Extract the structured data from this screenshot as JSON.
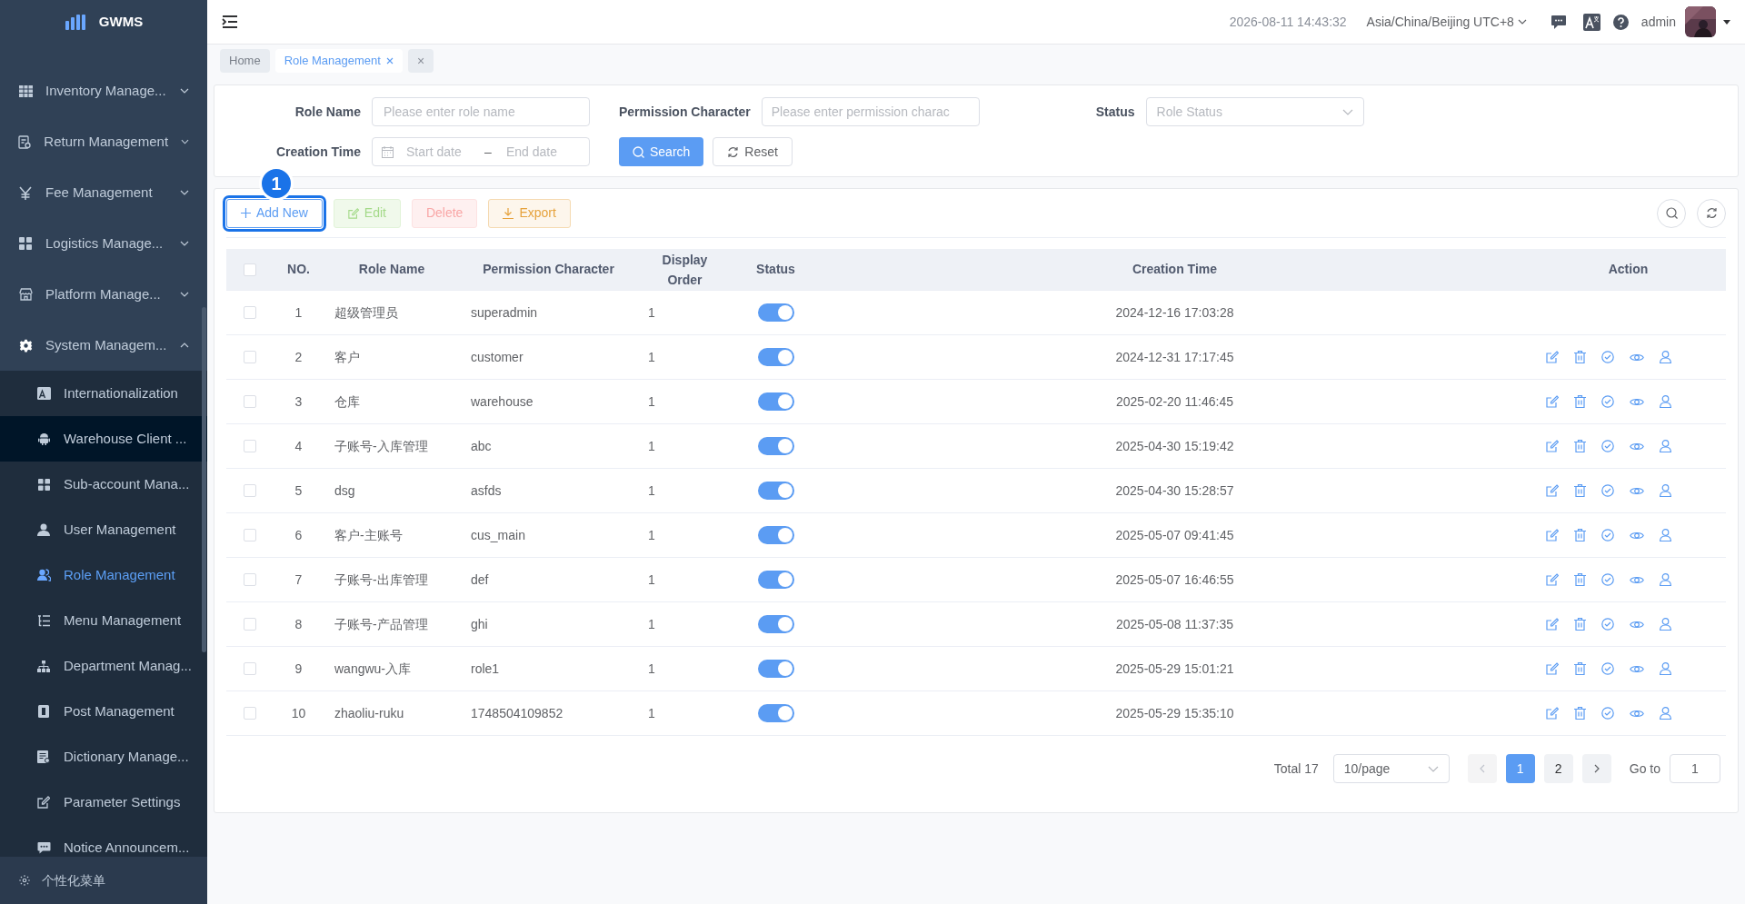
{
  "sidebar": {
    "logo": "GWMS",
    "items": [
      {
        "label": "Inventory Manage...",
        "expanded": false
      },
      {
        "label": "Return Management",
        "expanded": false
      },
      {
        "label": "Fee Management",
        "expanded": false
      },
      {
        "label": "Logistics Manage...",
        "expanded": false
      },
      {
        "label": "Platform Manage...",
        "expanded": false
      },
      {
        "label": "System Managem...",
        "expanded": true,
        "children": [
          {
            "label": "Internationalization",
            "selected": false,
            "hovered": false
          },
          {
            "label": "Warehouse Client ...",
            "selected": false,
            "hovered": true
          },
          {
            "label": "Sub-account Mana...",
            "selected": false,
            "hovered": false
          },
          {
            "label": "User Management",
            "selected": false,
            "hovered": false
          },
          {
            "label": "Role Management",
            "selected": true,
            "hovered": false
          },
          {
            "label": "Menu Management",
            "selected": false,
            "hovered": false
          },
          {
            "label": "Department Manag...",
            "selected": false,
            "hovered": false
          },
          {
            "label": "Post Management",
            "selected": false,
            "hovered": false
          },
          {
            "label": "Dictionary Manage...",
            "selected": false,
            "hovered": false
          },
          {
            "label": "Parameter Settings",
            "selected": false,
            "hovered": false
          },
          {
            "label": "Notice Announcem...",
            "selected": false,
            "hovered": false
          }
        ]
      }
    ],
    "footer": "个性化菜单"
  },
  "top_bar": {
    "datetime": "2026-08-11 14:43:32",
    "timezone": "Asia/China/Beijing UTC+8",
    "username": "admin"
  },
  "tabs": [
    {
      "label": "Home",
      "selected": false,
      "closable": false
    },
    {
      "label": "Role Management",
      "selected": true,
      "closable": true
    }
  ],
  "close_tabs_button": "×",
  "filters": {
    "role_name": {
      "label": "Role Name",
      "placeholder": "Please enter role name"
    },
    "permission_character": {
      "label": "Permission Character",
      "placeholder": "Please enter permission charac"
    },
    "status": {
      "label": "Status",
      "placeholder": "Role Status"
    },
    "creation_time": {
      "label": "Creation Time",
      "start_placeholder": "Start date",
      "separator": "–",
      "end_placeholder": "End date"
    },
    "search_button": "Search",
    "reset_button": "Reset"
  },
  "toolbar": [
    {
      "kind": "add",
      "label": "Add New",
      "disabled": false,
      "highlighted": true,
      "callout": "1"
    },
    {
      "kind": "edit",
      "label": "Edit",
      "disabled": true,
      "highlighted": false
    },
    {
      "kind": "delete",
      "label": "Delete",
      "disabled": true,
      "highlighted": false
    },
    {
      "kind": "export",
      "label": "Export",
      "disabled": false,
      "highlighted": false
    }
  ],
  "table": {
    "header_checked": false,
    "columns": [
      "NO.",
      "Role Name",
      "Permission Character",
      "Display Order",
      "Status",
      "Creation Time",
      "Action"
    ],
    "rows": [
      {
        "checked": false,
        "no": "1",
        "role_name": "超级管理员",
        "permission": "superadmin",
        "order": "1",
        "enabled": true,
        "created": "2024-12-16 17:03:28",
        "actions": false
      },
      {
        "checked": false,
        "no": "2",
        "role_name": "客户",
        "permission": "customer",
        "order": "1",
        "enabled": true,
        "created": "2024-12-31 17:17:45",
        "actions": true
      },
      {
        "checked": false,
        "no": "3",
        "role_name": "仓库",
        "permission": "warehouse",
        "order": "1",
        "enabled": true,
        "created": "2025-02-20 11:46:45",
        "actions": true
      },
      {
        "checked": false,
        "no": "4",
        "role_name": "子账号-入库管理",
        "permission": "abc",
        "order": "1",
        "enabled": true,
        "created": "2025-04-30 15:19:42",
        "actions": true
      },
      {
        "checked": false,
        "no": "5",
        "role_name": "dsg",
        "permission": "asfds",
        "order": "1",
        "enabled": true,
        "created": "2025-04-30 15:28:57",
        "actions": true
      },
      {
        "checked": false,
        "no": "6",
        "role_name": "客户-主账号",
        "permission": "cus_main",
        "order": "1",
        "enabled": true,
        "created": "2025-05-07 09:41:45",
        "actions": true
      },
      {
        "checked": false,
        "no": "7",
        "role_name": "子账号-出库管理",
        "permission": "def",
        "order": "1",
        "enabled": true,
        "created": "2025-05-07 16:46:55",
        "actions": true
      },
      {
        "checked": false,
        "no": "8",
        "role_name": "子账号-产品管理",
        "permission": "ghi",
        "order": "1",
        "enabled": true,
        "created": "2025-05-08 11:37:35",
        "actions": true
      },
      {
        "checked": false,
        "no": "9",
        "role_name": "wangwu-入库",
        "permission": "role1",
        "order": "1",
        "enabled": true,
        "created": "2025-05-29 15:01:21",
        "actions": true
      },
      {
        "checked": false,
        "no": "10",
        "role_name": "zhaoliu-ruku",
        "permission": "1748504109852",
        "order": "1",
        "enabled": true,
        "created": "2025-05-29 15:35:10",
        "actions": true
      }
    ]
  },
  "pagination": {
    "total": "Total 17",
    "page_size": "10/page",
    "pages": [
      {
        "label": "1",
        "selected": true
      },
      {
        "label": "2",
        "selected": false
      }
    ],
    "goto_label": "Go to",
    "goto_value": "1"
  }
}
